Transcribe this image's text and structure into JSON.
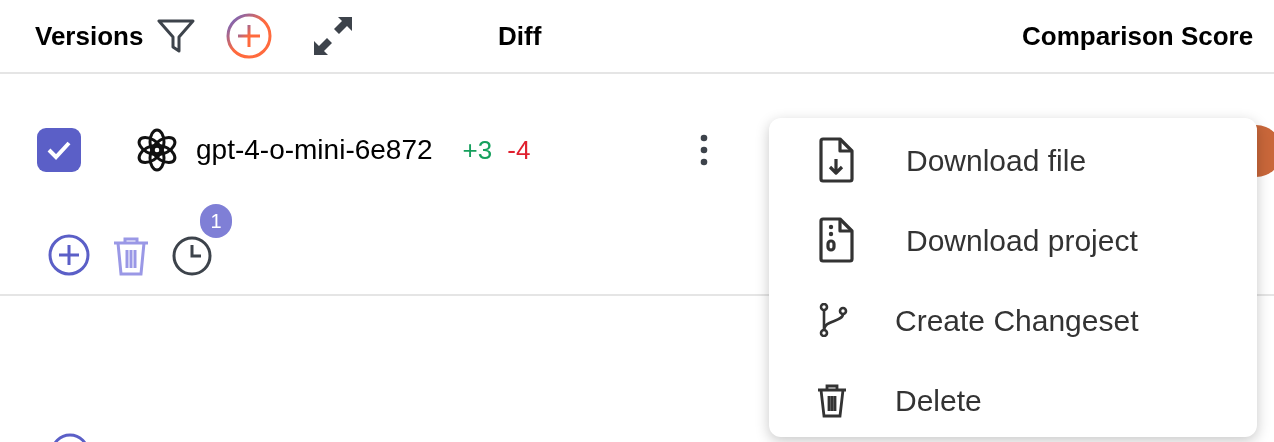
{
  "table": {
    "columns": [
      "Versions",
      "Diff",
      "Comparison Score"
    ],
    "rows": [
      {
        "checked": true,
        "name": "gpt-4-o-mini-6e872",
        "added": "+3",
        "removed": "-4",
        "history_count": "1"
      }
    ]
  },
  "context_menu": {
    "items": [
      {
        "kind": "download-file",
        "label": "Download file"
      },
      {
        "kind": "download-project",
        "label": "Download project"
      },
      {
        "kind": "branch",
        "label": "Create Changeset"
      },
      {
        "kind": "delete",
        "label": "Delete"
      }
    ]
  }
}
